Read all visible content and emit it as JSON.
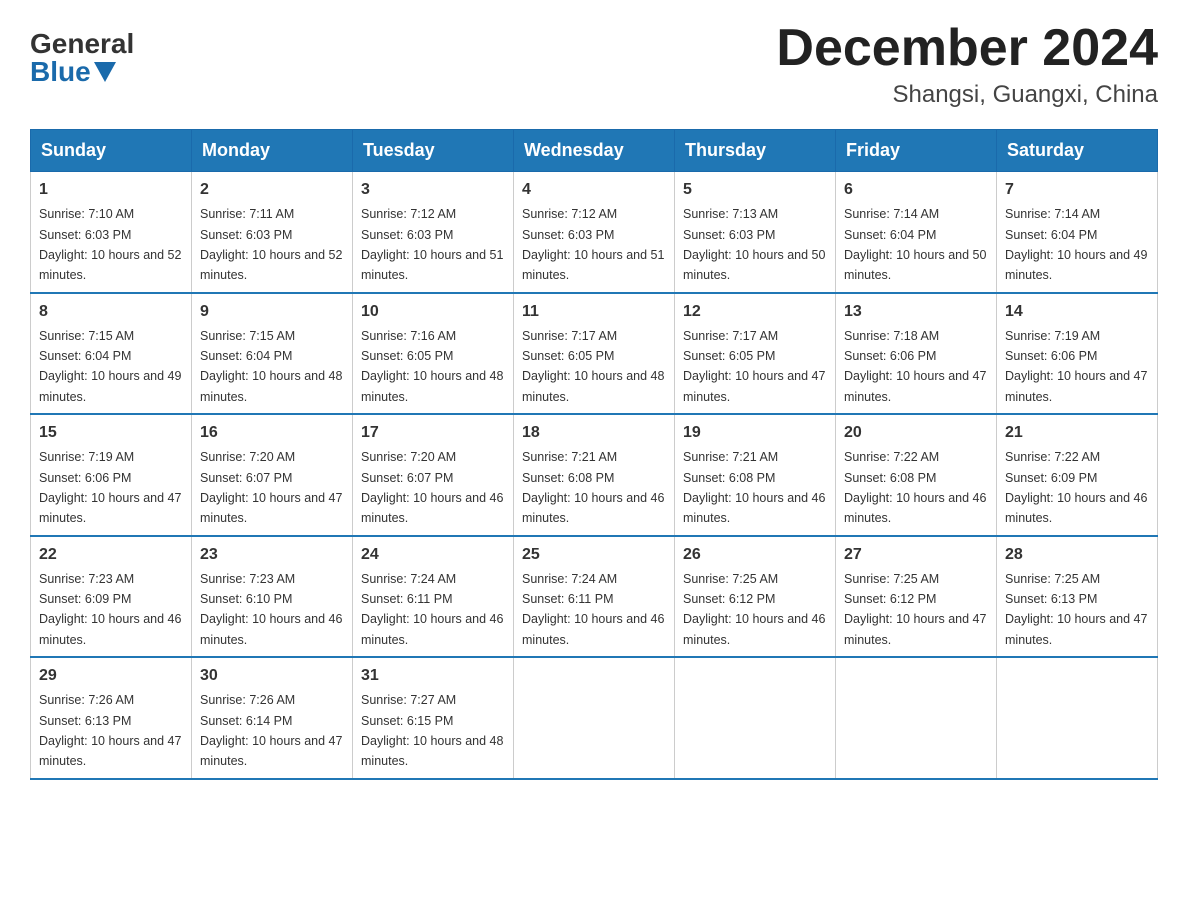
{
  "logo": {
    "general": "General",
    "blue": "Blue"
  },
  "header": {
    "month": "December 2024",
    "location": "Shangsi, Guangxi, China"
  },
  "weekdays": [
    "Sunday",
    "Monday",
    "Tuesday",
    "Wednesday",
    "Thursday",
    "Friday",
    "Saturday"
  ],
  "weeks": [
    [
      {
        "day": "1",
        "sunrise": "7:10 AM",
        "sunset": "6:03 PM",
        "daylight": "10 hours and 52 minutes."
      },
      {
        "day": "2",
        "sunrise": "7:11 AM",
        "sunset": "6:03 PM",
        "daylight": "10 hours and 52 minutes."
      },
      {
        "day": "3",
        "sunrise": "7:12 AM",
        "sunset": "6:03 PM",
        "daylight": "10 hours and 51 minutes."
      },
      {
        "day": "4",
        "sunrise": "7:12 AM",
        "sunset": "6:03 PM",
        "daylight": "10 hours and 51 minutes."
      },
      {
        "day": "5",
        "sunrise": "7:13 AM",
        "sunset": "6:03 PM",
        "daylight": "10 hours and 50 minutes."
      },
      {
        "day": "6",
        "sunrise": "7:14 AM",
        "sunset": "6:04 PM",
        "daylight": "10 hours and 50 minutes."
      },
      {
        "day": "7",
        "sunrise": "7:14 AM",
        "sunset": "6:04 PM",
        "daylight": "10 hours and 49 minutes."
      }
    ],
    [
      {
        "day": "8",
        "sunrise": "7:15 AM",
        "sunset": "6:04 PM",
        "daylight": "10 hours and 49 minutes."
      },
      {
        "day": "9",
        "sunrise": "7:15 AM",
        "sunset": "6:04 PM",
        "daylight": "10 hours and 48 minutes."
      },
      {
        "day": "10",
        "sunrise": "7:16 AM",
        "sunset": "6:05 PM",
        "daylight": "10 hours and 48 minutes."
      },
      {
        "day": "11",
        "sunrise": "7:17 AM",
        "sunset": "6:05 PM",
        "daylight": "10 hours and 48 minutes."
      },
      {
        "day": "12",
        "sunrise": "7:17 AM",
        "sunset": "6:05 PM",
        "daylight": "10 hours and 47 minutes."
      },
      {
        "day": "13",
        "sunrise": "7:18 AM",
        "sunset": "6:06 PM",
        "daylight": "10 hours and 47 minutes."
      },
      {
        "day": "14",
        "sunrise": "7:19 AM",
        "sunset": "6:06 PM",
        "daylight": "10 hours and 47 minutes."
      }
    ],
    [
      {
        "day": "15",
        "sunrise": "7:19 AM",
        "sunset": "6:06 PM",
        "daylight": "10 hours and 47 minutes."
      },
      {
        "day": "16",
        "sunrise": "7:20 AM",
        "sunset": "6:07 PM",
        "daylight": "10 hours and 47 minutes."
      },
      {
        "day": "17",
        "sunrise": "7:20 AM",
        "sunset": "6:07 PM",
        "daylight": "10 hours and 46 minutes."
      },
      {
        "day": "18",
        "sunrise": "7:21 AM",
        "sunset": "6:08 PM",
        "daylight": "10 hours and 46 minutes."
      },
      {
        "day": "19",
        "sunrise": "7:21 AM",
        "sunset": "6:08 PM",
        "daylight": "10 hours and 46 minutes."
      },
      {
        "day": "20",
        "sunrise": "7:22 AM",
        "sunset": "6:08 PM",
        "daylight": "10 hours and 46 minutes."
      },
      {
        "day": "21",
        "sunrise": "7:22 AM",
        "sunset": "6:09 PM",
        "daylight": "10 hours and 46 minutes."
      }
    ],
    [
      {
        "day": "22",
        "sunrise": "7:23 AM",
        "sunset": "6:09 PM",
        "daylight": "10 hours and 46 minutes."
      },
      {
        "day": "23",
        "sunrise": "7:23 AM",
        "sunset": "6:10 PM",
        "daylight": "10 hours and 46 minutes."
      },
      {
        "day": "24",
        "sunrise": "7:24 AM",
        "sunset": "6:11 PM",
        "daylight": "10 hours and 46 minutes."
      },
      {
        "day": "25",
        "sunrise": "7:24 AM",
        "sunset": "6:11 PM",
        "daylight": "10 hours and 46 minutes."
      },
      {
        "day": "26",
        "sunrise": "7:25 AM",
        "sunset": "6:12 PM",
        "daylight": "10 hours and 46 minutes."
      },
      {
        "day": "27",
        "sunrise": "7:25 AM",
        "sunset": "6:12 PM",
        "daylight": "10 hours and 47 minutes."
      },
      {
        "day": "28",
        "sunrise": "7:25 AM",
        "sunset": "6:13 PM",
        "daylight": "10 hours and 47 minutes."
      }
    ],
    [
      {
        "day": "29",
        "sunrise": "7:26 AM",
        "sunset": "6:13 PM",
        "daylight": "10 hours and 47 minutes."
      },
      {
        "day": "30",
        "sunrise": "7:26 AM",
        "sunset": "6:14 PM",
        "daylight": "10 hours and 47 minutes."
      },
      {
        "day": "31",
        "sunrise": "7:27 AM",
        "sunset": "6:15 PM",
        "daylight": "10 hours and 48 minutes."
      },
      null,
      null,
      null,
      null
    ]
  ]
}
